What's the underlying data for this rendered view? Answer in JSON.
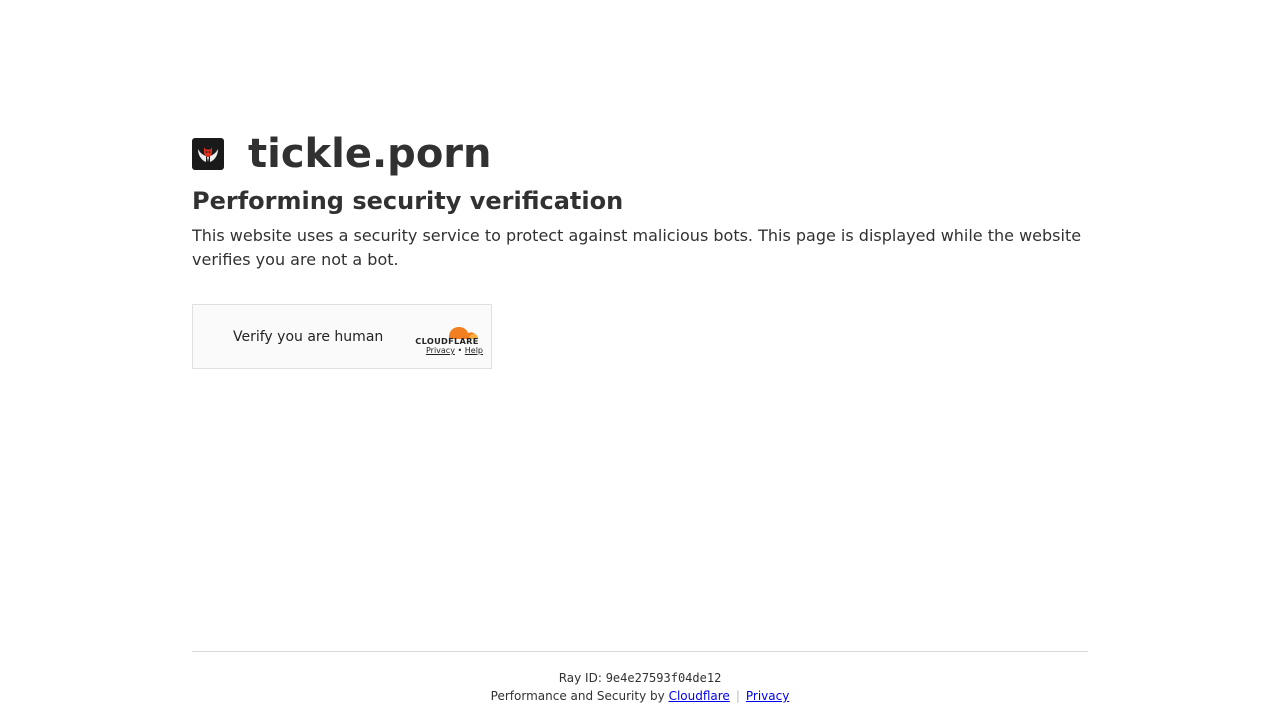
{
  "site": {
    "name": "tickle.porn",
    "favicon_icon": "winged-devil-logo-icon"
  },
  "verification": {
    "heading": "Performing security verification",
    "description": "This website uses a security service to protect against malicious bots. This page is displayed while the website verifies you are not a bot."
  },
  "widget": {
    "label": "Verify you are human",
    "brand_wordmark": "CLOUDFLARE",
    "privacy_link": "Privacy",
    "link_separator": "•",
    "help_link": "Help"
  },
  "footer": {
    "ray_label": "Ray ID:",
    "ray_id": "9e4e27593f04de12",
    "perf_text": "Performance and Security by",
    "cloudflare_link": "Cloudflare",
    "separator": "|",
    "privacy_link": "Privacy"
  },
  "colors": {
    "text": "#313131",
    "cloudflare_orange": "#f38020",
    "cloudflare_light_orange": "#faae40",
    "link_blue": "#0000ee"
  }
}
